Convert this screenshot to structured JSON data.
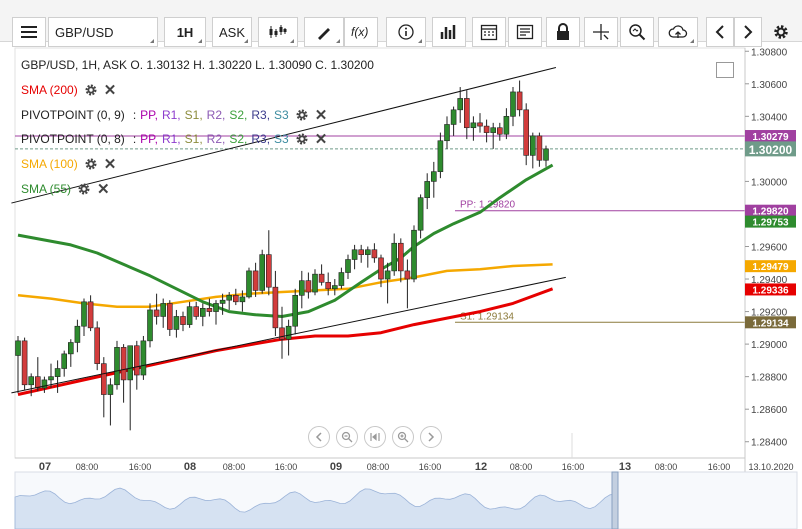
{
  "toolbar": {
    "symbol": "GBP/USD",
    "timeframe": "1H",
    "price_type": "ASK",
    "icons": [
      "menu-icon",
      "candles-icon",
      "draw-icon",
      "fx-icon",
      "info-icon",
      "volume-icon",
      "calendar-icon",
      "news-icon",
      "lock-icon",
      "crosshair-icon",
      "zoom-icon",
      "cloud-icon",
      "prev-icon",
      "next-icon",
      "settings-icon"
    ]
  },
  "legend": {
    "ohlc": "GBP/USD, 1H, ASK   O. 1.30132 H. 1.30220 L. 1.30090 C. 1.30200",
    "sma200": "SMA (200)",
    "pivot1_name": "PIVOTPOINT (0, 9)",
    "pivot2_name": "PIVOTPOINT (0, 8)",
    "sma100": "SMA (100)",
    "sma55": "SMA (55)",
    "pivot_sep": ":",
    "pivot_items": [
      "PP,",
      "R1,",
      "S1,",
      "R2,",
      "S2,",
      "R3,",
      "S3"
    ],
    "pivot_colors": [
      "#aa00aa",
      "#8c3ccd",
      "#8c8c3c",
      "#8c5ab4",
      "#3ca03c",
      "#3c3c8c",
      "#3c8ca0"
    ],
    "close_glyph": "✕"
  },
  "chart_data": {
    "type": "candlestick",
    "symbol": "GBP/USD",
    "timeframe": "1H",
    "last_ohlc": {
      "o": 1.30132,
      "h": 1.3022,
      "l": 1.3009,
      "c": 1.302
    },
    "y_ticks": [
      "1.30800",
      "1.30600",
      "1.30400",
      "1.30200",
      "1.30000",
      "1.29800",
      "1.29600",
      "1.29400",
      "1.29200",
      "1.29000",
      "1.28800",
      "1.28600",
      "1.28400"
    ],
    "ylim": [
      1.283,
      1.3082
    ],
    "x_ticks": [
      "07",
      "08:00",
      "16:00",
      "08",
      "08:00",
      "16:00",
      "09",
      "08:00",
      "16:00",
      "12",
      "08:00",
      "16:00",
      "13",
      "08:00",
      "16:00",
      "13.10.2020"
    ],
    "x_tick_bold": [
      true,
      false,
      false,
      true,
      false,
      false,
      true,
      false,
      false,
      true,
      false,
      false,
      true,
      false,
      false,
      false
    ],
    "price_labels": [
      {
        "text": "1.30279",
        "value": 1.30279,
        "color": "#a040a0"
      },
      {
        "text": "1.30200",
        "value": 1.302,
        "color": "#6f9b89"
      },
      {
        "text": "1.29820",
        "value": 1.2982,
        "color": "#a040a0"
      },
      {
        "text": "1.29753",
        "value": 1.29753,
        "color": "#2e8b2e"
      },
      {
        "text": "1.29479",
        "value": 1.29479,
        "color": "#f5a800"
      },
      {
        "text": "1.29336",
        "value": 1.29336,
        "color": "#e60000"
      },
      {
        "text": "1.29134",
        "value": 1.29134,
        "color": "#7a6a3a"
      }
    ],
    "levels": [
      {
        "name": "PP: 1.29820",
        "value": 1.2982,
        "color": "#a040a0"
      },
      {
        "name": "S1: 1.29134",
        "value": 1.29134,
        "color": "#8c7a3c"
      }
    ],
    "candles": [
      {
        "o": 1.2893,
        "h": 1.2905,
        "l": 1.287,
        "c": 1.2902
      },
      {
        "o": 1.2902,
        "h": 1.2904,
        "l": 1.2872,
        "c": 1.2875
      },
      {
        "o": 1.2875,
        "h": 1.2882,
        "l": 1.2868,
        "c": 1.288
      },
      {
        "o": 1.288,
        "h": 1.2892,
        "l": 1.2871,
        "c": 1.2873
      },
      {
        "o": 1.2873,
        "h": 1.288,
        "l": 1.287,
        "c": 1.2878
      },
      {
        "o": 1.2878,
        "h": 1.2888,
        "l": 1.2873,
        "c": 1.288
      },
      {
        "o": 1.288,
        "h": 1.289,
        "l": 1.287,
        "c": 1.2885
      },
      {
        "o": 1.2885,
        "h": 1.2896,
        "l": 1.288,
        "c": 1.2894
      },
      {
        "o": 1.2894,
        "h": 1.2903,
        "l": 1.2886,
        "c": 1.2901
      },
      {
        "o": 1.2901,
        "h": 1.2915,
        "l": 1.2895,
        "c": 1.2911
      },
      {
        "o": 1.2911,
        "h": 1.2928,
        "l": 1.2905,
        "c": 1.2926
      },
      {
        "o": 1.2926,
        "h": 1.293,
        "l": 1.2908,
        "c": 1.291
      },
      {
        "o": 1.291,
        "h": 1.2914,
        "l": 1.2884,
        "c": 1.2888
      },
      {
        "o": 1.2888,
        "h": 1.2892,
        "l": 1.2855,
        "c": 1.2869
      },
      {
        "o": 1.2869,
        "h": 1.2879,
        "l": 1.285,
        "c": 1.2875
      },
      {
        "o": 1.2875,
        "h": 1.2902,
        "l": 1.2872,
        "c": 1.2898
      },
      {
        "o": 1.2898,
        "h": 1.29,
        "l": 1.2864,
        "c": 1.2878
      },
      {
        "o": 1.2878,
        "h": 1.2885,
        "l": 1.2847,
        "c": 1.2899
      },
      {
        "o": 1.2899,
        "h": 1.2902,
        "l": 1.2872,
        "c": 1.2881
      },
      {
        "o": 1.2881,
        "h": 1.2905,
        "l": 1.2878,
        "c": 1.2902
      },
      {
        "o": 1.2902,
        "h": 1.2925,
        "l": 1.2898,
        "c": 1.2921
      },
      {
        "o": 1.2921,
        "h": 1.2931,
        "l": 1.2912,
        "c": 1.2917
      },
      {
        "o": 1.2917,
        "h": 1.2928,
        "l": 1.291,
        "c": 1.2925
      },
      {
        "o": 1.2925,
        "h": 1.2927,
        "l": 1.2905,
        "c": 1.2909
      },
      {
        "o": 1.2909,
        "h": 1.2921,
        "l": 1.2904,
        "c": 1.2917
      },
      {
        "o": 1.2917,
        "h": 1.292,
        "l": 1.2908,
        "c": 1.2912
      },
      {
        "o": 1.2912,
        "h": 1.2926,
        "l": 1.291,
        "c": 1.2923
      },
      {
        "o": 1.2923,
        "h": 1.2926,
        "l": 1.2915,
        "c": 1.2917
      },
      {
        "o": 1.2917,
        "h": 1.2925,
        "l": 1.2911,
        "c": 1.2922
      },
      {
        "o": 1.2922,
        "h": 1.2928,
        "l": 1.2917,
        "c": 1.292
      },
      {
        "o": 1.292,
        "h": 1.2927,
        "l": 1.2912,
        "c": 1.2925
      },
      {
        "o": 1.2925,
        "h": 1.2931,
        "l": 1.2918,
        "c": 1.2927
      },
      {
        "o": 1.2927,
        "h": 1.2932,
        "l": 1.2921,
        "c": 1.293
      },
      {
        "o": 1.293,
        "h": 1.2934,
        "l": 1.2924,
        "c": 1.2926
      },
      {
        "o": 1.2926,
        "h": 1.2933,
        "l": 1.292,
        "c": 1.2929
      },
      {
        "o": 1.2929,
        "h": 1.2947,
        "l": 1.2928,
        "c": 1.2945
      },
      {
        "o": 1.2945,
        "h": 1.295,
        "l": 1.2929,
        "c": 1.2933
      },
      {
        "o": 1.2933,
        "h": 1.2958,
        "l": 1.2931,
        "c": 1.2955
      },
      {
        "o": 1.2955,
        "h": 1.297,
        "l": 1.293,
        "c": 1.2935
      },
      {
        "o": 1.2935,
        "h": 1.2945,
        "l": 1.2905,
        "c": 1.291
      },
      {
        "o": 1.291,
        "h": 1.2923,
        "l": 1.2891,
        "c": 1.2903
      },
      {
        "o": 1.2903,
        "h": 1.2915,
        "l": 1.2893,
        "c": 1.2911
      },
      {
        "o": 1.2911,
        "h": 1.2934,
        "l": 1.2906,
        "c": 1.293
      },
      {
        "o": 1.293,
        "h": 1.2945,
        "l": 1.2922,
        "c": 1.2939
      },
      {
        "o": 1.2939,
        "h": 1.2944,
        "l": 1.2928,
        "c": 1.2932
      },
      {
        "o": 1.2932,
        "h": 1.2946,
        "l": 1.293,
        "c": 1.2943
      },
      {
        "o": 1.2943,
        "h": 1.2949,
        "l": 1.2936,
        "c": 1.2938
      },
      {
        "o": 1.2938,
        "h": 1.2944,
        "l": 1.293,
        "c": 1.2934
      },
      {
        "o": 1.2934,
        "h": 1.294,
        "l": 1.293,
        "c": 1.2936
      },
      {
        "o": 1.2936,
        "h": 1.2947,
        "l": 1.2934,
        "c": 1.2944
      },
      {
        "o": 1.2944,
        "h": 1.2955,
        "l": 1.294,
        "c": 1.2952
      },
      {
        "o": 1.2952,
        "h": 1.2961,
        "l": 1.2946,
        "c": 1.2958
      },
      {
        "o": 1.2958,
        "h": 1.2961,
        "l": 1.295,
        "c": 1.2955
      },
      {
        "o": 1.2955,
        "h": 1.296,
        "l": 1.2947,
        "c": 1.2958
      },
      {
        "o": 1.2958,
        "h": 1.2962,
        "l": 1.295,
        "c": 1.2953
      },
      {
        "o": 1.2953,
        "h": 1.2955,
        "l": 1.2935,
        "c": 1.294
      },
      {
        "o": 1.294,
        "h": 1.295,
        "l": 1.2925,
        "c": 1.2945
      },
      {
        "o": 1.2945,
        "h": 1.2968,
        "l": 1.2942,
        "c": 1.2962
      },
      {
        "o": 1.2962,
        "h": 1.2965,
        "l": 1.2938,
        "c": 1.2945
      },
      {
        "o": 1.2945,
        "h": 1.2952,
        "l": 1.2922,
        "c": 1.294
      },
      {
        "o": 1.294,
        "h": 1.2973,
        "l": 1.2938,
        "c": 1.297
      },
      {
        "o": 1.297,
        "h": 1.2992,
        "l": 1.2965,
        "c": 1.299
      },
      {
        "o": 1.299,
        "h": 1.3005,
        "l": 1.2983,
        "c": 1.3
      },
      {
        "o": 1.3,
        "h": 1.3012,
        "l": 1.299,
        "c": 1.3006
      },
      {
        "o": 1.3006,
        "h": 1.303,
        "l": 1.3002,
        "c": 1.3025
      },
      {
        "o": 1.3025,
        "h": 1.304,
        "l": 1.302,
        "c": 1.3035
      },
      {
        "o": 1.3035,
        "h": 1.3046,
        "l": 1.3028,
        "c": 1.3044
      },
      {
        "o": 1.3044,
        "h": 1.3058,
        "l": 1.3036,
        "c": 1.3051
      },
      {
        "o": 1.3051,
        "h": 1.3056,
        "l": 1.3026,
        "c": 1.3033
      },
      {
        "o": 1.3033,
        "h": 1.304,
        "l": 1.3025,
        "c": 1.3036
      },
      {
        "o": 1.3036,
        "h": 1.3042,
        "l": 1.303,
        "c": 1.3034
      },
      {
        "o": 1.3034,
        "h": 1.3038,
        "l": 1.3024,
        "c": 1.303
      },
      {
        "o": 1.303,
        "h": 1.3036,
        "l": 1.302,
        "c": 1.3033
      },
      {
        "o": 1.3033,
        "h": 1.3036,
        "l": 1.3025,
        "c": 1.3029
      },
      {
        "o": 1.3029,
        "h": 1.3045,
        "l": 1.3026,
        "c": 1.304
      },
      {
        "o": 1.304,
        "h": 1.3058,
        "l": 1.3034,
        "c": 1.3055
      },
      {
        "o": 1.3055,
        "h": 1.3062,
        "l": 1.304,
        "c": 1.3044
      },
      {
        "o": 1.3044,
        "h": 1.3048,
        "l": 1.301,
        "c": 1.3016
      },
      {
        "o": 1.3016,
        "h": 1.303,
        "l": 1.3008,
        "c": 1.3028
      },
      {
        "o": 1.3028,
        "h": 1.303,
        "l": 1.3009,
        "c": 1.3013
      },
      {
        "o": 1.3013,
        "h": 1.3022,
        "l": 1.3009,
        "c": 1.302
      }
    ],
    "sma55": [
      [
        0,
        1.2967
      ],
      [
        4,
        1.2964
      ],
      [
        8,
        1.2961
      ],
      [
        12,
        1.2956
      ],
      [
        16,
        1.2949
      ],
      [
        20,
        1.2942
      ],
      [
        24,
        1.2934
      ],
      [
        28,
        1.2926
      ],
      [
        32,
        1.292
      ],
      [
        36,
        1.2918
      ],
      [
        40,
        1.2917
      ],
      [
        44,
        1.292
      ],
      [
        48,
        1.2927
      ],
      [
        52,
        1.2938
      ],
      [
        55,
        1.2946
      ],
      [
        58,
        1.2953
      ],
      [
        60,
        1.296
      ],
      [
        63,
        1.2968
      ],
      [
        66,
        1.2974
      ],
      [
        70,
        1.2981
      ],
      [
        73,
        1.299
      ],
      [
        77,
        1.3001
      ],
      [
        81,
        1.301
      ]
    ],
    "sma100": [
      [
        0,
        1.293
      ],
      [
        5,
        1.2928
      ],
      [
        10,
        1.2925
      ],
      [
        15,
        1.2923
      ],
      [
        20,
        1.2923
      ],
      [
        25,
        1.2926
      ],
      [
        30,
        1.2929
      ],
      [
        35,
        1.2931
      ],
      [
        40,
        1.2932
      ],
      [
        45,
        1.2933
      ],
      [
        50,
        1.2934
      ],
      [
        55,
        1.2938
      ],
      [
        60,
        1.2941
      ],
      [
        65,
        1.2945
      ],
      [
        70,
        1.2946
      ],
      [
        75,
        1.2948
      ],
      [
        81,
        1.2949
      ]
    ],
    "sma200": [
      [
        0,
        1.2869
      ],
      [
        10,
        1.2878
      ],
      [
        20,
        1.2887
      ],
      [
        30,
        1.2896
      ],
      [
        40,
        1.2903
      ],
      [
        45,
        1.2905
      ],
      [
        50,
        1.2905
      ],
      [
        55,
        1.2907
      ],
      [
        60,
        1.2912
      ],
      [
        65,
        1.2916
      ],
      [
        70,
        1.292
      ],
      [
        75,
        1.2925
      ],
      [
        81,
        1.2934
      ]
    ],
    "channel_upper": [
      [
        -1,
        1.29867
      ],
      [
        81.5,
        1.307
      ]
    ],
    "channel_lower": [
      [
        -1,
        1.287
      ],
      [
        83,
        1.2941
      ]
    ]
  }
}
